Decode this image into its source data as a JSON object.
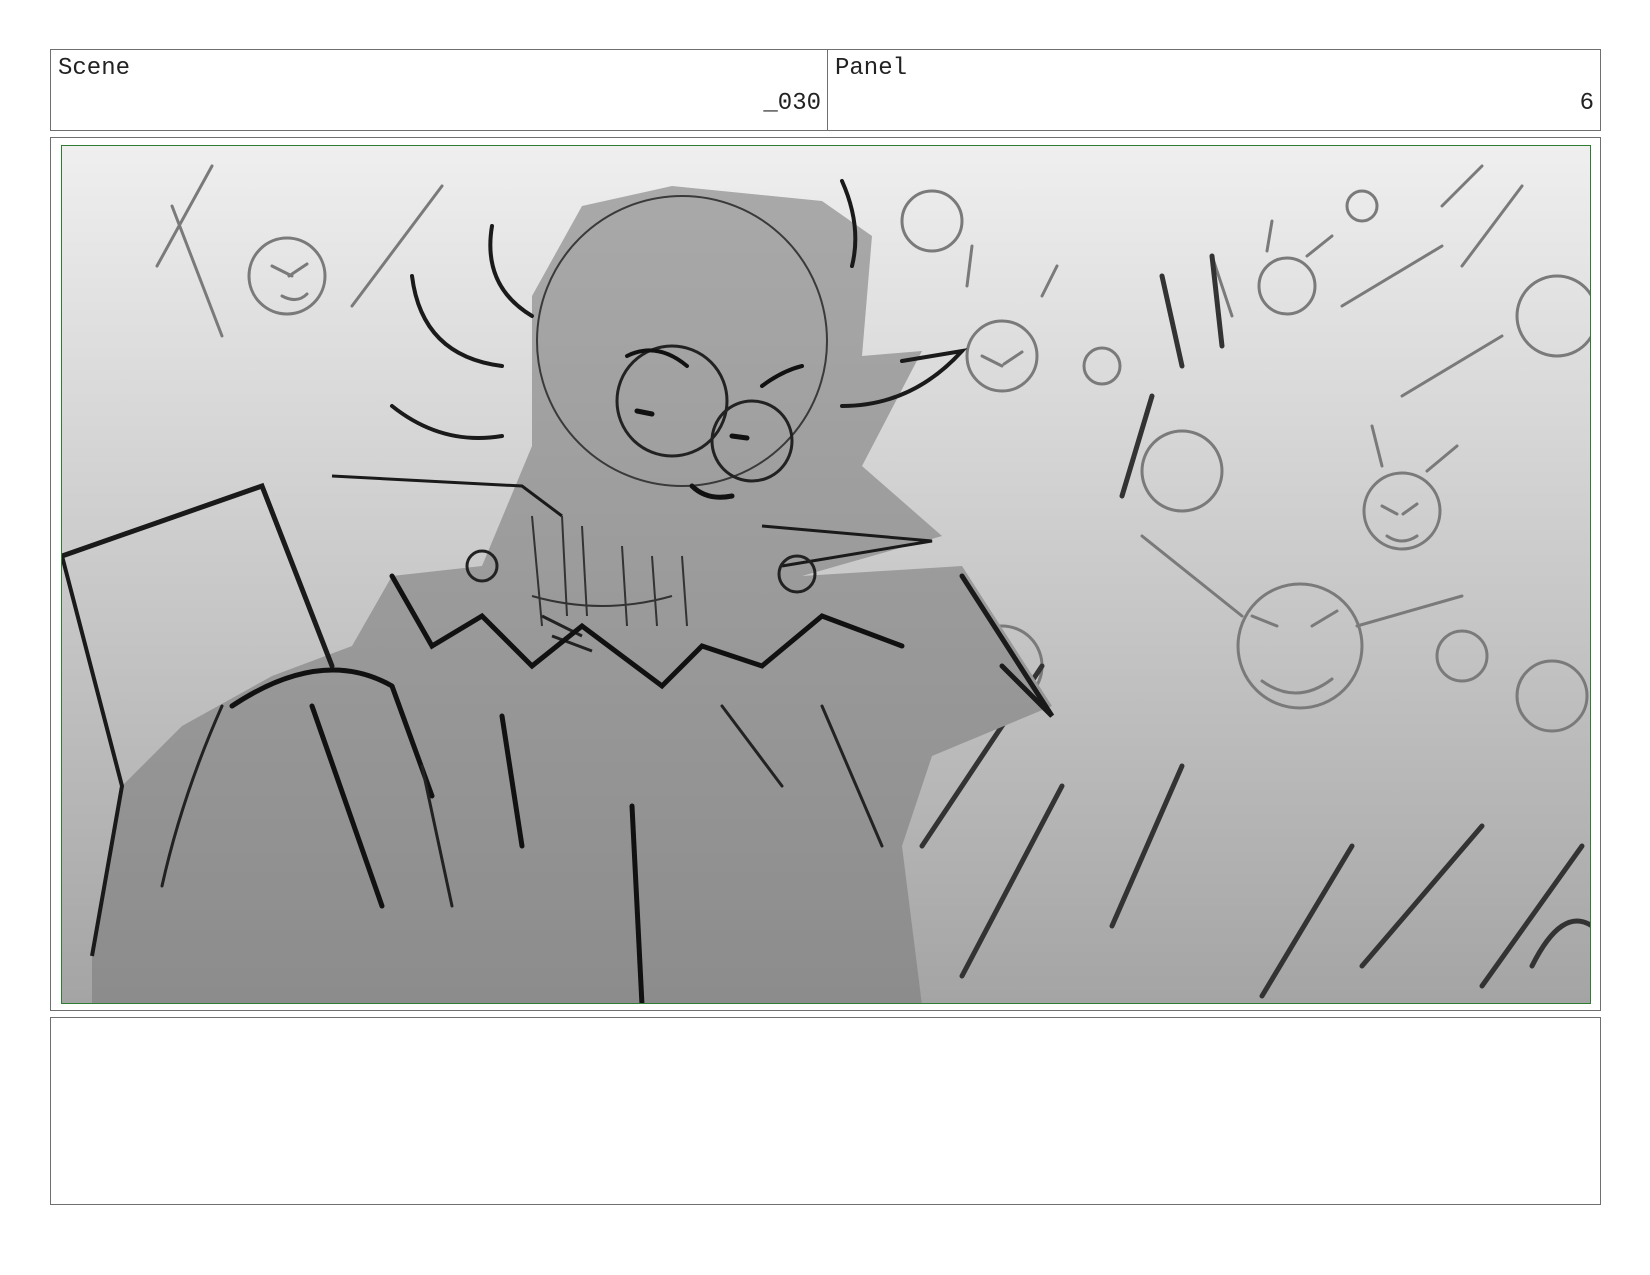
{
  "header": {
    "scene_label": "Scene",
    "scene_value": "_030",
    "panel_label": "Panel",
    "panel_value": "6"
  },
  "frame": {
    "border_color": "#2e7d32",
    "background_top": "#efefef",
    "background_bottom": "#9a9a9a",
    "content": "storyboard-sketch-horned-character-with-glasses-and-crowd"
  },
  "notes": {
    "text": ""
  }
}
